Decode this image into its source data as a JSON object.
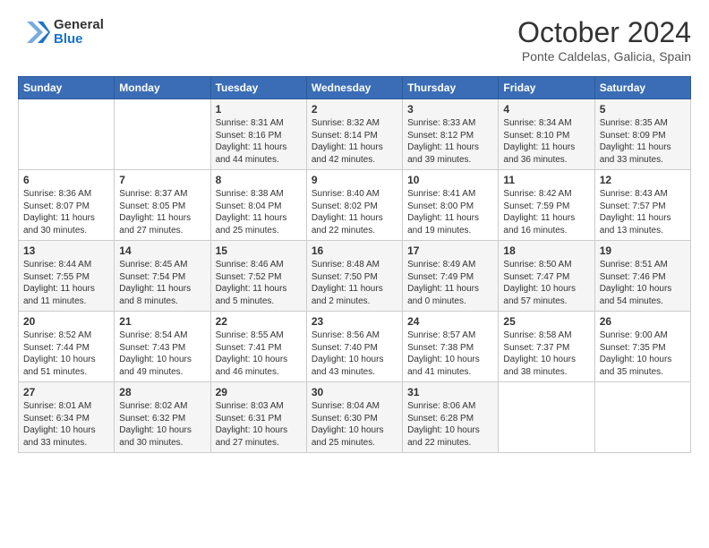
{
  "logo": {
    "line1": "General",
    "line2": "Blue"
  },
  "header": {
    "month": "October 2024",
    "location": "Ponte Caldelas, Galicia, Spain"
  },
  "weekdays": [
    "Sunday",
    "Monday",
    "Tuesday",
    "Wednesday",
    "Thursday",
    "Friday",
    "Saturday"
  ],
  "weeks": [
    [
      {
        "day": "",
        "info": ""
      },
      {
        "day": "",
        "info": ""
      },
      {
        "day": "1",
        "info": "Sunrise: 8:31 AM\nSunset: 8:16 PM\nDaylight: 11 hours\nand 44 minutes."
      },
      {
        "day": "2",
        "info": "Sunrise: 8:32 AM\nSunset: 8:14 PM\nDaylight: 11 hours\nand 42 minutes."
      },
      {
        "day": "3",
        "info": "Sunrise: 8:33 AM\nSunset: 8:12 PM\nDaylight: 11 hours\nand 39 minutes."
      },
      {
        "day": "4",
        "info": "Sunrise: 8:34 AM\nSunset: 8:10 PM\nDaylight: 11 hours\nand 36 minutes."
      },
      {
        "day": "5",
        "info": "Sunrise: 8:35 AM\nSunset: 8:09 PM\nDaylight: 11 hours\nand 33 minutes."
      }
    ],
    [
      {
        "day": "6",
        "info": "Sunrise: 8:36 AM\nSunset: 8:07 PM\nDaylight: 11 hours\nand 30 minutes."
      },
      {
        "day": "7",
        "info": "Sunrise: 8:37 AM\nSunset: 8:05 PM\nDaylight: 11 hours\nand 27 minutes."
      },
      {
        "day": "8",
        "info": "Sunrise: 8:38 AM\nSunset: 8:04 PM\nDaylight: 11 hours\nand 25 minutes."
      },
      {
        "day": "9",
        "info": "Sunrise: 8:40 AM\nSunset: 8:02 PM\nDaylight: 11 hours\nand 22 minutes."
      },
      {
        "day": "10",
        "info": "Sunrise: 8:41 AM\nSunset: 8:00 PM\nDaylight: 11 hours\nand 19 minutes."
      },
      {
        "day": "11",
        "info": "Sunrise: 8:42 AM\nSunset: 7:59 PM\nDaylight: 11 hours\nand 16 minutes."
      },
      {
        "day": "12",
        "info": "Sunrise: 8:43 AM\nSunset: 7:57 PM\nDaylight: 11 hours\nand 13 minutes."
      }
    ],
    [
      {
        "day": "13",
        "info": "Sunrise: 8:44 AM\nSunset: 7:55 PM\nDaylight: 11 hours\nand 11 minutes."
      },
      {
        "day": "14",
        "info": "Sunrise: 8:45 AM\nSunset: 7:54 PM\nDaylight: 11 hours\nand 8 minutes."
      },
      {
        "day": "15",
        "info": "Sunrise: 8:46 AM\nSunset: 7:52 PM\nDaylight: 11 hours\nand 5 minutes."
      },
      {
        "day": "16",
        "info": "Sunrise: 8:48 AM\nSunset: 7:50 PM\nDaylight: 11 hours\nand 2 minutes."
      },
      {
        "day": "17",
        "info": "Sunrise: 8:49 AM\nSunset: 7:49 PM\nDaylight: 11 hours\nand 0 minutes."
      },
      {
        "day": "18",
        "info": "Sunrise: 8:50 AM\nSunset: 7:47 PM\nDaylight: 10 hours\nand 57 minutes."
      },
      {
        "day": "19",
        "info": "Sunrise: 8:51 AM\nSunset: 7:46 PM\nDaylight: 10 hours\nand 54 minutes."
      }
    ],
    [
      {
        "day": "20",
        "info": "Sunrise: 8:52 AM\nSunset: 7:44 PM\nDaylight: 10 hours\nand 51 minutes."
      },
      {
        "day": "21",
        "info": "Sunrise: 8:54 AM\nSunset: 7:43 PM\nDaylight: 10 hours\nand 49 minutes."
      },
      {
        "day": "22",
        "info": "Sunrise: 8:55 AM\nSunset: 7:41 PM\nDaylight: 10 hours\nand 46 minutes."
      },
      {
        "day": "23",
        "info": "Sunrise: 8:56 AM\nSunset: 7:40 PM\nDaylight: 10 hours\nand 43 minutes."
      },
      {
        "day": "24",
        "info": "Sunrise: 8:57 AM\nSunset: 7:38 PM\nDaylight: 10 hours\nand 41 minutes."
      },
      {
        "day": "25",
        "info": "Sunrise: 8:58 AM\nSunset: 7:37 PM\nDaylight: 10 hours\nand 38 minutes."
      },
      {
        "day": "26",
        "info": "Sunrise: 9:00 AM\nSunset: 7:35 PM\nDaylight: 10 hours\nand 35 minutes."
      }
    ],
    [
      {
        "day": "27",
        "info": "Sunrise: 8:01 AM\nSunset: 6:34 PM\nDaylight: 10 hours\nand 33 minutes."
      },
      {
        "day": "28",
        "info": "Sunrise: 8:02 AM\nSunset: 6:32 PM\nDaylight: 10 hours\nand 30 minutes."
      },
      {
        "day": "29",
        "info": "Sunrise: 8:03 AM\nSunset: 6:31 PM\nDaylight: 10 hours\nand 27 minutes."
      },
      {
        "day": "30",
        "info": "Sunrise: 8:04 AM\nSunset: 6:30 PM\nDaylight: 10 hours\nand 25 minutes."
      },
      {
        "day": "31",
        "info": "Sunrise: 8:06 AM\nSunset: 6:28 PM\nDaylight: 10 hours\nand 22 minutes."
      },
      {
        "day": "",
        "info": ""
      },
      {
        "day": "",
        "info": ""
      }
    ]
  ]
}
